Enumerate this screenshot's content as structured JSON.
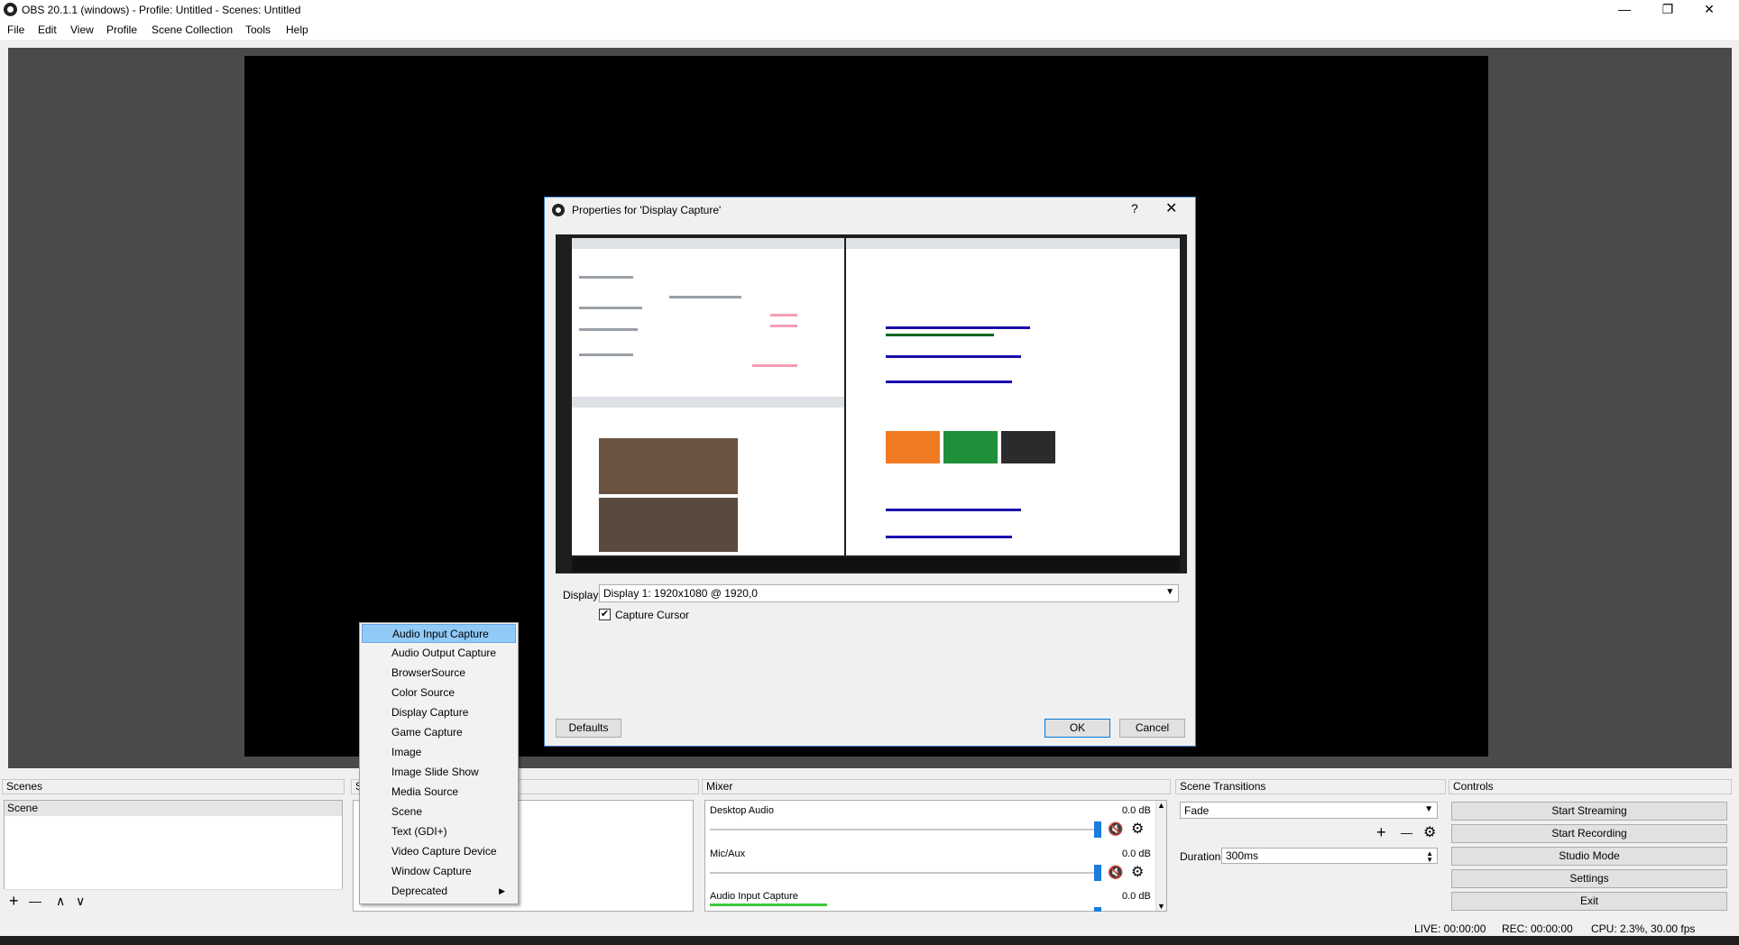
{
  "window": {
    "title": "OBS 20.1.1 (windows) - Profile: Untitled - Scenes: Untitled",
    "minimize": "—",
    "restore": "❐",
    "close": "✕"
  },
  "menu": [
    "File",
    "Edit",
    "View",
    "Profile",
    "Scene Collection",
    "Tools",
    "Help"
  ],
  "dialog": {
    "title": "Properties for 'Display Capture'",
    "help": "?",
    "close": "✕",
    "display_label": "Display",
    "display_value": "Display 1: 1920x1080 @ 1920,0",
    "capture_cursor_label": "Capture Cursor",
    "capture_cursor_checked": "✔",
    "defaults": "Defaults",
    "ok": "OK",
    "cancel": "Cancel"
  },
  "scenes": {
    "header": "Scenes",
    "items": [
      "Scene"
    ],
    "add": "+",
    "remove": "—",
    "up": "∧",
    "down": "∨"
  },
  "sources": {
    "header": "S"
  },
  "mixer": {
    "header": "Mixer",
    "channels": [
      {
        "name": "Desktop Audio",
        "db": "0.0 dB"
      },
      {
        "name": "Mic/Aux",
        "db": "0.0 dB"
      },
      {
        "name": "Audio Input Capture",
        "db": "0.0 dB"
      }
    ],
    "scroll_up": "▲",
    "scroll_down": "▼"
  },
  "transitions": {
    "header": "Scene Transitions",
    "selected": "Fade",
    "add": "+",
    "remove": "—",
    "duration_label": "Duration",
    "duration_value": "300ms"
  },
  "controls": {
    "header": "Controls",
    "buttons": [
      "Start Streaming",
      "Start Recording",
      "Studio Mode",
      "Settings",
      "Exit"
    ]
  },
  "status": {
    "live": "LIVE: 00:00:00",
    "rec": "REC: 00:00:00",
    "cpu": "CPU: 2.3%, 30.00 fps"
  },
  "context_menu": {
    "items": [
      "Audio Input Capture",
      "Audio Output Capture",
      "BrowserSource",
      "Color Source",
      "Display Capture",
      "Game Capture",
      "Image",
      "Image Slide Show",
      "Media Source",
      "Scene",
      "Text (GDI+)",
      "Video Capture Device",
      "Window Capture",
      "Deprecated"
    ],
    "highlighted": "Audio Input Capture",
    "submenu_arrow": "▶"
  },
  "colors": {
    "accent": "#3d78c8",
    "highlight": "#91c9f7",
    "volume_handle": "#1a7cdd",
    "mute": "#e00000"
  }
}
